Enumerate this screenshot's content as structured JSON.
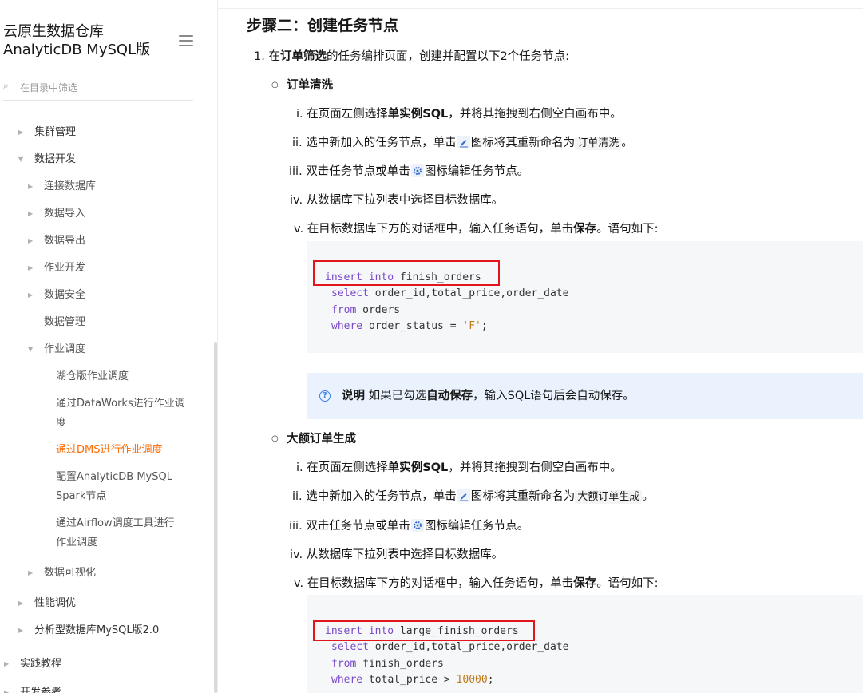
{
  "sidebar": {
    "title_line1": "云原生数据仓库",
    "title_line2": "AnalyticDB MySQL版",
    "search_placeholder": "在目录中筛选",
    "items": [
      {
        "label": "集群管理"
      },
      {
        "label": "数据开发"
      },
      {
        "label": "连接数据库"
      },
      {
        "label": "数据导入"
      },
      {
        "label": "数据导出"
      },
      {
        "label": "作业开发"
      },
      {
        "label": "数据安全"
      },
      {
        "label": "数据管理"
      },
      {
        "label": "作业调度"
      },
      {
        "label": "湖仓版作业调度"
      },
      {
        "label_line1": "通过DataWorks进行作业调",
        "label_line2": "度"
      },
      {
        "label": "通过DMS进行作业调度"
      },
      {
        "label_line1": "配置AnalyticDB MySQL",
        "label_line2": "Spark节点"
      },
      {
        "label_line1": "通过Airflow调度工具进行",
        "label_line2": "作业调度"
      },
      {
        "label": "数据可视化"
      },
      {
        "label": "性能调优"
      },
      {
        "label": "分析型数据库MySQL版2.0"
      },
      {
        "label": "实践教程"
      },
      {
        "label": "开发参考"
      }
    ]
  },
  "main": {
    "heading": "步骤二：创建任务节点",
    "step1": {
      "num": "1.",
      "pre": "在",
      "bold": "订单筛选",
      "post": "的任务编排页面，创建并配置以下2个任务节点:"
    },
    "node1": {
      "title": "订单清洗",
      "s1": {
        "num": "i.",
        "pre": "在页面左侧选择",
        "bold": "单实例SQL",
        "post": "，并将其拖拽到右侧空白画布中。"
      },
      "s2": {
        "num": "ii.",
        "pre": "选中新加入的任务节点，单击",
        "mid": "图标将其重新命名为",
        "code": "订单清洗",
        "post": "。"
      },
      "s3": {
        "num": "iii.",
        "pre": "双击任务节点或单击",
        "post": "图标编辑任务节点。"
      },
      "s4": {
        "num": "iv.",
        "text": "从数据库下拉列表中选择目标数据库。"
      },
      "s5": {
        "num": "v.",
        "pre": "在目标数据库下方的对话框中，输入任务语句，单击",
        "bold": "保存",
        "post": "。语句如下:"
      },
      "code": {
        "l1_kw1": "insert",
        "l1_kw2": "into",
        "l1_rest": "finish_orders",
        "l2_kw": "select",
        "l2_rest": "order_id,total_price,order_date",
        "l3_kw": "from",
        "l3_rest": "orders",
        "l4_kw": "where",
        "l4_rest": "order_status = ",
        "l4_str": "'F'",
        "l4_end": ";"
      }
    },
    "note": {
      "label": "说明",
      "pre": "如果已勾选",
      "bold": "自动保存",
      "post": "，输入SQL语句后会自动保存。"
    },
    "node2": {
      "title": "大额订单生成",
      "s1": {
        "num": "i.",
        "pre": "在页面左侧选择",
        "bold": "单实例SQL",
        "post": "，并将其拖拽到右侧空白画布中。"
      },
      "s2": {
        "num": "ii.",
        "pre": "选中新加入的任务节点，单击",
        "mid": "图标将其重新命名为",
        "code": "大额订单生成",
        "post": "。"
      },
      "s3": {
        "num": "iii.",
        "pre": "双击任务节点或单击",
        "post": "图标编辑任务节点。"
      },
      "s4": {
        "num": "iv.",
        "text": "从数据库下拉列表中选择目标数据库。"
      },
      "s5": {
        "num": "v.",
        "pre": "在目标数据库下方的对话框中，输入任务语句，单击",
        "bold": "保存",
        "post": "。语句如下:"
      },
      "code": {
        "l1_kw1": "insert",
        "l1_kw2": "into",
        "l1_rest": "large_finish_orders",
        "l2_kw": "select",
        "l2_rest": "order_id,total_price,order_date",
        "l3_kw": "from",
        "l3_rest": "finish_orders",
        "l4_kw": "where",
        "l4_rest": "total_price > ",
        "l4_num": "10000",
        "l4_end": ";"
      }
    }
  }
}
